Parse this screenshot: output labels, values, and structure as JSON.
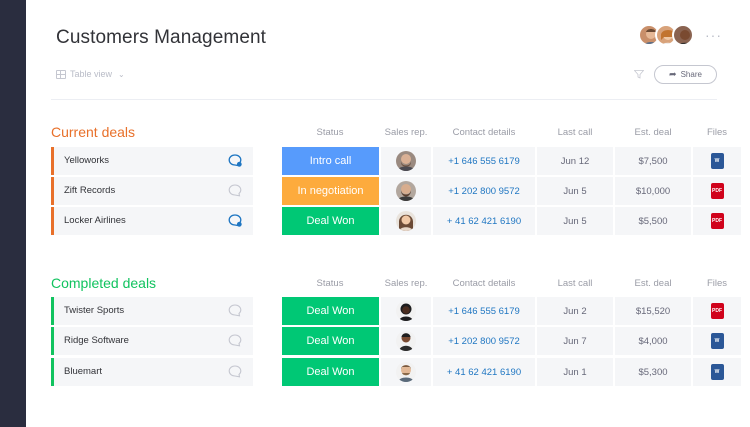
{
  "app": {
    "title": "Customers Management",
    "view_label": "Table view",
    "share_label": "Share",
    "more_menu": "···"
  },
  "colors": {
    "sidebar": "#2a2d3f",
    "current_group": "#e8702a",
    "completed_group": "#11c35f",
    "status_intro_call": "#579bfc",
    "status_negotiation": "#fdab3d",
    "status_deal_won": "#00c875",
    "contact_link": "#1f76c2",
    "word_file": "#2b5797",
    "pdf_file": "#d0021b"
  },
  "columns": {
    "status": "Status",
    "sales_rep": "Sales rep.",
    "contact": "Contact details",
    "last_call": "Last call",
    "est_deal": "Est. deal",
    "files": "Files"
  },
  "groups": [
    {
      "title": "Current deals",
      "color": "#e8702a",
      "rows": [
        {
          "name": "Yelloworks",
          "chat_active": true,
          "status": "Intro call",
          "status_color": "#579bfc",
          "rep_icon": "rep-avatar",
          "contact": "+1 646 555 6179",
          "last_call": "Jun 12",
          "est_deal": "$7,500",
          "file_type": "word",
          "file_label": "W"
        },
        {
          "name": "Zift Records",
          "chat_active": false,
          "status": "In negotiation",
          "status_color": "#fdab3d",
          "rep_icon": "rep-avatar",
          "contact": "+1 202 800 9572",
          "last_call": "Jun 5",
          "est_deal": "$10,000",
          "file_type": "pdf",
          "file_label": "PDF"
        },
        {
          "name": "Locker Airlines",
          "chat_active": true,
          "status": "Deal Won",
          "status_color": "#00c875",
          "rep_icon": "rep-avatar",
          "contact": "+ 41 62 421 6190",
          "last_call": "Jun 5",
          "est_deal": "$5,500",
          "file_type": "pdf",
          "file_label": "PDF"
        }
      ]
    },
    {
      "title": "Completed deals",
      "color": "#11c35f",
      "rows": [
        {
          "name": "Twister Sports",
          "chat_active": false,
          "status": "Deal Won",
          "status_color": "#00c875",
          "rep_icon": "rep-avatar",
          "contact": "+1 646 555 6179",
          "last_call": "Jun 2",
          "est_deal": "$15,520",
          "file_type": "pdf",
          "file_label": "PDF"
        },
        {
          "name": "Ridge Software",
          "chat_active": false,
          "status": "Deal Won",
          "status_color": "#00c875",
          "rep_icon": "rep-avatar",
          "contact": "+1 202 800 9572",
          "last_call": "Jun 7",
          "est_deal": "$4,000",
          "file_type": "word",
          "file_label": "W"
        },
        {
          "name": "Bluemart",
          "chat_active": false,
          "status": "Deal Won",
          "status_color": "#00c875",
          "rep_icon": "rep-avatar",
          "contact": "+ 41 62 421 6190",
          "last_call": "Jun 1",
          "est_deal": "$5,300",
          "file_type": "word",
          "file_label": "W"
        }
      ]
    }
  ]
}
